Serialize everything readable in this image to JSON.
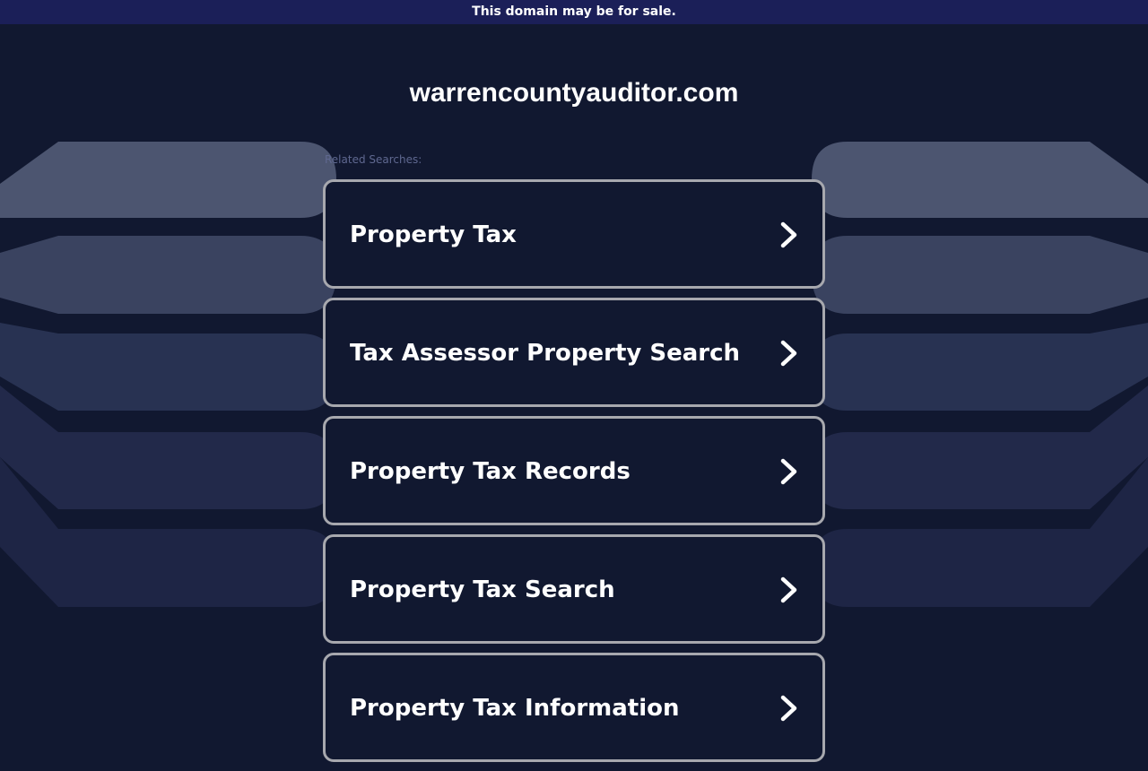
{
  "banner": {
    "text": "This domain may be for sale."
  },
  "header": {
    "domain": "warrencountyauditor.com"
  },
  "related": {
    "label": "Related Searches:",
    "items": [
      {
        "label": "Property Tax",
        "icon": "chevron-right-icon"
      },
      {
        "label": "Tax Assessor Property Search",
        "icon": "chevron-right-icon"
      },
      {
        "label": "Property Tax Records",
        "icon": "chevron-right-icon"
      },
      {
        "label": "Property Tax Search",
        "icon": "chevron-right-icon"
      },
      {
        "label": "Property Tax Information",
        "icon": "chevron-right-icon"
      }
    ]
  },
  "colors": {
    "background": "#111830",
    "banner": "#1b1f58",
    "card_border": "#a7a8ae",
    "text": "#ffffff"
  }
}
